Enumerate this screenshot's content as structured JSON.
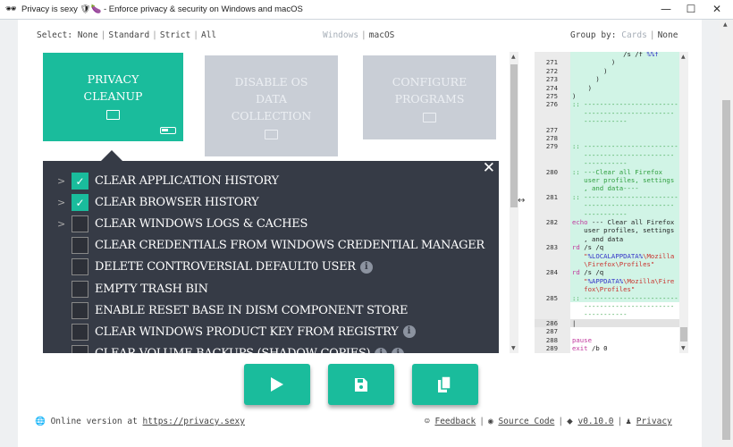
{
  "window": {
    "title": "Privacy is sexy 🛡🍆 - Enforce privacy & security on Windows and macOS",
    "minimize": "—",
    "maximize": "☐",
    "close": "✕"
  },
  "select": {
    "label": "Select:",
    "options": [
      "None",
      "Standard",
      "Strict",
      "All"
    ]
  },
  "os": {
    "options": [
      "Windows",
      "macOS"
    ],
    "selected": "macOS"
  },
  "group": {
    "label": "Group by:",
    "options": [
      "Cards",
      "None"
    ],
    "selected": "None"
  },
  "cards": [
    {
      "title": "PRIVACY CLEANUP",
      "lines": [
        "PRIVACY",
        "CLEANUP"
      ],
      "active": true,
      "progress": "partial"
    },
    {
      "title": "DISABLE OS DATA COLLECTION",
      "lines": [
        "DISABLE OS",
        "DATA",
        "COLLECTION"
      ],
      "active": false
    },
    {
      "title": "CONFIGURE PROGRAMS",
      "lines": [
        "CONFIGURE",
        "PROGRAMS"
      ],
      "active": false
    }
  ],
  "scripts": [
    {
      "label": "CLEAR APPLICATION HISTORY",
      "checked": true,
      "expandable": true,
      "info": 0
    },
    {
      "label": "CLEAR BROWSER HISTORY",
      "checked": true,
      "expandable": true,
      "info": 0
    },
    {
      "label": "CLEAR WINDOWS LOGS & CACHES",
      "checked": false,
      "expandable": true,
      "info": 0
    },
    {
      "label": "CLEAR CREDENTIALS FROM WINDOWS CREDENTIAL MANAGER",
      "checked": false,
      "expandable": false,
      "info": 0
    },
    {
      "label": "DELETE CONTROVERSIAL DEFAULT0 USER",
      "checked": false,
      "expandable": false,
      "info": 1
    },
    {
      "label": "EMPTY TRASH BIN",
      "checked": false,
      "expandable": false,
      "info": 0
    },
    {
      "label": "ENABLE RESET BASE IN DISM COMPONENT STORE",
      "checked": false,
      "expandable": false,
      "info": 0
    },
    {
      "label": "CLEAR WINDOWS PRODUCT KEY FROM REGISTRY",
      "checked": false,
      "expandable": false,
      "info": 1
    },
    {
      "label": "CLEAR VOLUME BACKUPS (SHADOW COPIES)",
      "checked": false,
      "expandable": false,
      "info": 2
    }
  ],
  "code": {
    "rows": [
      {
        "n": "",
        "hl": true,
        "s": [
          [
            "tx",
            "             /s /f "
          ],
          [
            "va",
            "%%f"
          ]
        ]
      },
      {
        "n": "271",
        "hl": true,
        "s": [
          [
            "tx",
            "          )"
          ]
        ]
      },
      {
        "n": "272",
        "hl": true,
        "s": [
          [
            "tx",
            "        )"
          ]
        ]
      },
      {
        "n": "273",
        "hl": true,
        "s": [
          [
            "tx",
            "      )"
          ]
        ]
      },
      {
        "n": "274",
        "hl": true,
        "s": [
          [
            "tx",
            "    )"
          ]
        ]
      },
      {
        "n": "275",
        "hl": true,
        "s": [
          [
            "tx",
            ")"
          ]
        ]
      },
      {
        "n": "276",
        "hl": true,
        "s": [
          [
            "cm",
            ":: ------------------------"
          ]
        ]
      },
      {
        "n": "",
        "hl": true,
        "s": [
          [
            "cm",
            "   -----------------------"
          ]
        ]
      },
      {
        "n": "",
        "hl": true,
        "s": [
          [
            "cm",
            "   -----------"
          ]
        ]
      },
      {
        "n": "277",
        "hl": true,
        "s": []
      },
      {
        "n": "278",
        "hl": true,
        "s": []
      },
      {
        "n": "279",
        "hl": true,
        "s": [
          [
            "cm",
            ":: ------------------------"
          ]
        ]
      },
      {
        "n": "",
        "hl": true,
        "s": [
          [
            "cm",
            "   -----------------------"
          ]
        ]
      },
      {
        "n": "",
        "hl": true,
        "s": [
          [
            "cm",
            "   -----------"
          ]
        ]
      },
      {
        "n": "280",
        "hl": true,
        "s": [
          [
            "cm",
            ":: ---Clear all Firefox"
          ]
        ]
      },
      {
        "n": "",
        "hl": true,
        "s": [
          [
            "cm",
            "   user profiles, settings"
          ]
        ]
      },
      {
        "n": "",
        "hl": true,
        "s": [
          [
            "cm",
            "   , and data----"
          ]
        ]
      },
      {
        "n": "281",
        "hl": true,
        "s": [
          [
            "cm",
            ":: ------------------------"
          ]
        ]
      },
      {
        "n": "",
        "hl": true,
        "s": [
          [
            "cm",
            "   -----------------------"
          ]
        ]
      },
      {
        "n": "",
        "hl": true,
        "s": [
          [
            "cm",
            "   -----------"
          ]
        ]
      },
      {
        "n": "282",
        "hl": true,
        "s": [
          [
            "kw",
            "echo"
          ],
          [
            "tx",
            " --- Clear all Firefox"
          ]
        ]
      },
      {
        "n": "",
        "hl": true,
        "s": [
          [
            "tx",
            "   user profiles, settings"
          ]
        ]
      },
      {
        "n": "",
        "hl": true,
        "s": [
          [
            "tx",
            "   , and data"
          ]
        ]
      },
      {
        "n": "283",
        "hl": true,
        "s": [
          [
            "kw",
            "rd"
          ],
          [
            "tx",
            " /s /q"
          ]
        ]
      },
      {
        "n": "",
        "hl": true,
        "s": [
          [
            "st",
            "   \""
          ],
          [
            "va",
            "%LOCALAPPDATA%"
          ],
          [
            "st",
            "\\Mozilla"
          ]
        ]
      },
      {
        "n": "",
        "hl": true,
        "s": [
          [
            "st",
            "   \\Firefox\\Profiles\""
          ]
        ]
      },
      {
        "n": "284",
        "hl": true,
        "s": [
          [
            "kw",
            "rd"
          ],
          [
            "tx",
            " /s /q"
          ]
        ]
      },
      {
        "n": "",
        "hl": true,
        "s": [
          [
            "st",
            "   \""
          ],
          [
            "va",
            "%APPDATA%"
          ],
          [
            "st",
            "\\Mozilla\\Fire"
          ]
        ]
      },
      {
        "n": "",
        "hl": true,
        "s": [
          [
            "st",
            "   fox\\Profiles\""
          ]
        ]
      },
      {
        "n": "285",
        "hl": true,
        "s": [
          [
            "cm",
            ":: ------------------------"
          ]
        ]
      },
      {
        "n": "",
        "hl": false,
        "s": [
          [
            "cm",
            "   -----------------------"
          ]
        ]
      },
      {
        "n": "",
        "hl": false,
        "s": [
          [
            "cm",
            "   -----------"
          ]
        ]
      },
      {
        "n": "286",
        "cur": true,
        "s": [
          [
            "tx",
            "|"
          ]
        ]
      },
      {
        "n": "287",
        "s": []
      },
      {
        "n": "288",
        "s": [
          [
            "kw",
            "pause"
          ]
        ]
      },
      {
        "n": "289",
        "s": [
          [
            "kw",
            "exit"
          ],
          [
            "tx",
            " /b 0"
          ]
        ]
      }
    ]
  },
  "actions": [
    {
      "name": "run",
      "icon": "play-icon"
    },
    {
      "name": "save",
      "icon": "save-icon"
    },
    {
      "name": "copy",
      "icon": "copy-icon"
    }
  ],
  "footer": {
    "online_prefix": "Online version at",
    "online_link": "https://privacy.sexy",
    "feedback": "Feedback",
    "source": "Source Code",
    "version": "v0.10.0",
    "privacy": "Privacy"
  },
  "colors": {
    "accent": "#1abc9c",
    "panel": "#363b46",
    "inactive_card": "#c9ced6",
    "code_highlight": "#d1f4e6"
  }
}
